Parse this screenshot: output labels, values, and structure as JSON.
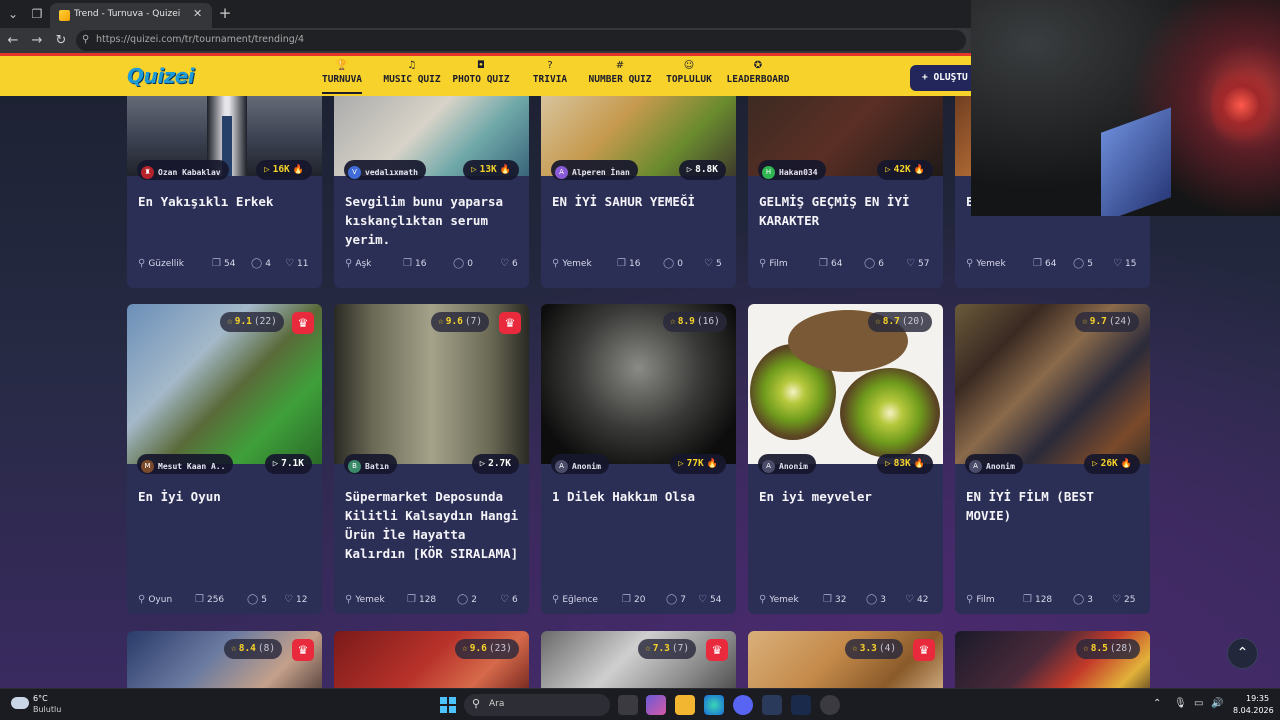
{
  "browser": {
    "tab_title": "Trend - Turnuva - Quizei",
    "url": "https://quizei.com/tr/tournament/trending/4"
  },
  "site": {
    "logo": "Quizei",
    "nav": [
      {
        "label": "TURNUVA",
        "icon": "trophy-icon",
        "active": true
      },
      {
        "label": "MUSIC QUIZ",
        "icon": "music-note-icon"
      },
      {
        "label": "PHOTO QUIZ",
        "icon": "camera-icon"
      },
      {
        "label": "TRIVIA",
        "icon": "question-circle-icon"
      },
      {
        "label": "NUMBER QUIZ",
        "icon": "hash-icon"
      },
      {
        "label": "TOPLULUK",
        "icon": "users-icon"
      },
      {
        "label": "LEADERBOARD",
        "icon": "medal-icon"
      }
    ],
    "create_label": "OLUŞTU"
  },
  "cards_row1": [
    {
      "creator": "Ozan Kabaklav",
      "plays": "16K",
      "hot": true,
      "title": "En Yakışıklı Erkek",
      "category": "Güzellik",
      "items": "54",
      "comments": "4",
      "likes": "11"
    },
    {
      "creator": "vedalıxmath",
      "plays": "13K",
      "hot": true,
      "title": "Sevgilim bunu yaparsa kıskançlıktan serum yerim.",
      "category": "Aşk",
      "items": "16",
      "comments": "0",
      "likes": "6"
    },
    {
      "creator": "Alperen İnan",
      "plays": "8.8K",
      "hot": false,
      "title": "EN İYİ SAHUR YEMEĞİ",
      "category": "Yemek",
      "items": "16",
      "comments": "0",
      "likes": "5"
    },
    {
      "creator": "Hakan034",
      "plays": "42K",
      "hot": true,
      "title": "GELMİŞ GEÇMİŞ EN İYİ KARAKTER",
      "category": "Film",
      "items": "64",
      "comments": "6",
      "likes": "57"
    },
    {
      "creator": "",
      "plays": "",
      "hot": false,
      "title": "E",
      "category": "Yemek",
      "items": "64",
      "comments": "5",
      "likes": "15"
    }
  ],
  "cards_row2": [
    {
      "rating": "9.1",
      "votes": "(22)",
      "creator": "Mesut Kaan A..",
      "plays": "7.1K",
      "hot": false,
      "title": "En İyi Oyun",
      "category": "Oyun",
      "items": "256",
      "comments": "5",
      "likes": "12"
    },
    {
      "rating": "9.6",
      "votes": "(7)",
      "creator": "Batın",
      "plays": "2.7K",
      "hot": false,
      "title": "Süpermarket Deposunda Kilitli Kalsaydın Hangi Ürün İle Hayatta Kalırdın [KÖR SIRALAMA]",
      "category": "Yemek",
      "items": "128",
      "comments": "2",
      "likes": "6"
    },
    {
      "rating": "8.9",
      "votes": "(16)",
      "creator": "Anonim",
      "plays": "77K",
      "hot": true,
      "title": "1 Dilek Hakkım Olsa",
      "category": "Eğlence",
      "items": "20",
      "comments": "7",
      "likes": "54"
    },
    {
      "rating": "8.7",
      "votes": "(20)",
      "creator": "Anonim",
      "plays": "83K",
      "hot": true,
      "title": "En iyi meyveler",
      "category": "Yemek",
      "items": "32",
      "comments": "3",
      "likes": "42"
    },
    {
      "rating": "9.7",
      "votes": "(24)",
      "creator": "Anonim",
      "plays": "26K",
      "hot": true,
      "title": "EN İYİ FİLM (BEST MOVIE)",
      "category": "Film",
      "items": "128",
      "comments": "3",
      "likes": "25"
    }
  ],
  "cards_row3": [
    {
      "rating": "8.4",
      "votes": "(8)",
      "crown": true
    },
    {
      "rating": "9.6",
      "votes": "(23)",
      "crown": false
    },
    {
      "rating": "7.3",
      "votes": "(7)",
      "crown": true
    },
    {
      "rating": "3.3",
      "votes": "(4)",
      "crown": true
    },
    {
      "rating": "8.5",
      "votes": "(28)",
      "crown": false
    }
  ],
  "taskbar": {
    "weather_temp": "6°C",
    "weather_desc": "Bulutlu",
    "search_placeholder": "Ara",
    "time": "19:35",
    "date": "8.04.2026"
  },
  "colors": {
    "header_yellow": "#f6d22a",
    "card_bg": "#2b2e55",
    "crown_red": "#e82a3c",
    "accent_yellow": "#f6d22a"
  }
}
